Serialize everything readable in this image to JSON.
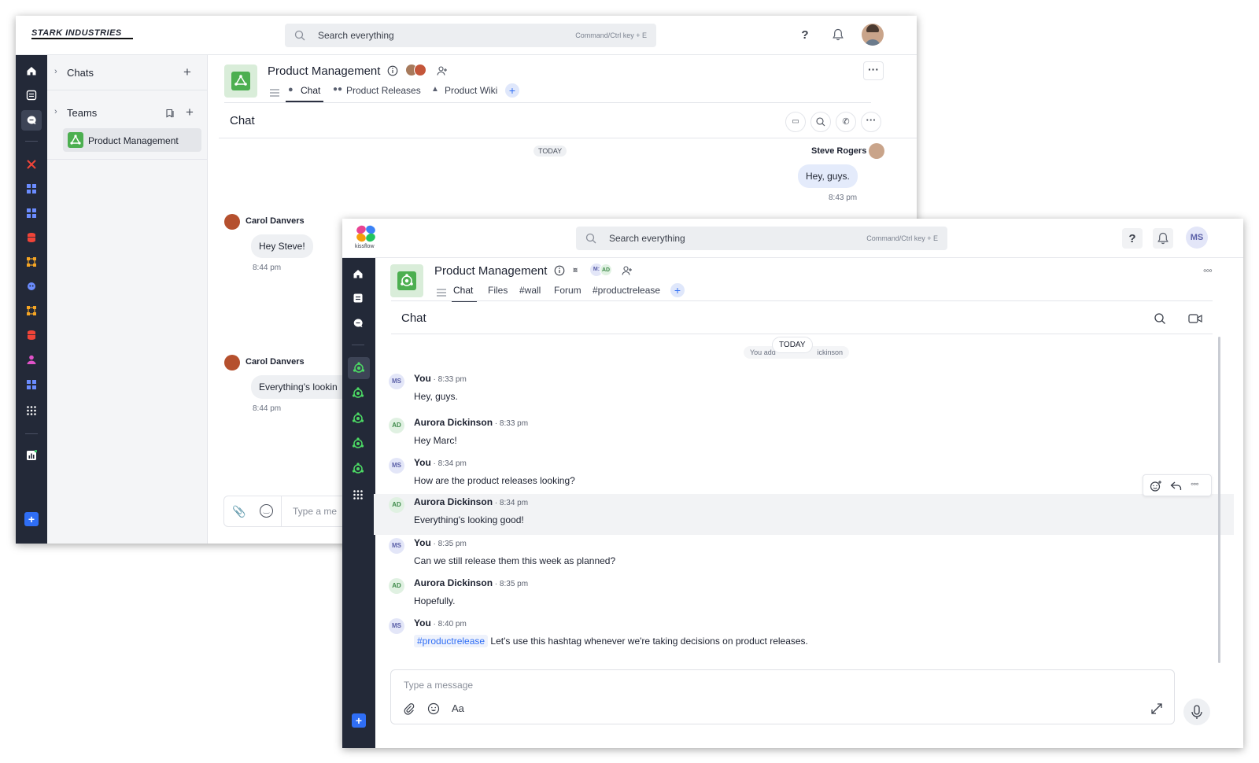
{
  "back_window": {
    "brand": "STARK INDUSTRIES",
    "search": {
      "placeholder": "Search everything",
      "hint": "Command/Ctrl key + E"
    },
    "sidebar": {
      "chats_label": "Chats",
      "teams_label": "Teams",
      "team_item": "Product Management"
    },
    "channel": {
      "title": "Product Management",
      "tabs": [
        "Chat",
        "Product Releases",
        "Product Wiki"
      ]
    },
    "chat_header": "Chat",
    "date_divider": "TODAY",
    "messages": [
      {
        "author": "Steve Rogers",
        "text": "Hey, guys.",
        "time": "8:43 pm"
      },
      {
        "author": "Carol Danvers",
        "text": "Hey Steve!",
        "time": "8:44 pm"
      },
      {
        "author": "Carol Danvers",
        "text": "Everything's lookin",
        "time": "8:44 pm"
      }
    ],
    "composer_placeholder": "Type a me"
  },
  "front_window": {
    "brand": "kissflow",
    "search": {
      "placeholder": "Search everything",
      "hint": "Command/Ctrl key + E"
    },
    "user_initials": "MS",
    "channel": {
      "title": "Product Management",
      "member_initials": [
        "M:",
        "AD"
      ],
      "tabs": [
        "Chat",
        "Files",
        "#wall",
        "Forum",
        "#productrelease"
      ]
    },
    "chat_header": "Chat",
    "date_divider": "TODAY",
    "system_message_left": "You add",
    "system_message_right": "ickinson",
    "messages": [
      {
        "initials": "MS",
        "author": "You",
        "time": "8:33 pm",
        "text": "Hey, guys."
      },
      {
        "initials": "AD",
        "author": "Aurora Dickinson",
        "time": "8:33 pm",
        "text": "Hey Marc!"
      },
      {
        "initials": "MS",
        "author": "You",
        "time": "8:34 pm",
        "text": "How are the product releases looking?"
      },
      {
        "initials": "AD",
        "author": "Aurora Dickinson",
        "time": "8:34 pm",
        "text": "Everything's looking good!"
      },
      {
        "initials": "MS",
        "author": "You",
        "time": "8:35 pm",
        "text": "Can we still release them this week as planned?"
      },
      {
        "initials": "AD",
        "author": "Aurora Dickinson",
        "time": "8:35 pm",
        "text": "Hopefully."
      },
      {
        "initials": "MS",
        "author": "You",
        "time": "8:40 pm",
        "hashtag": "#productrelease",
        "text": "Let's use this hashtag whenever we're taking decisions on product releases."
      }
    ],
    "composer": {
      "placeholder": "Type a message",
      "format_label": "Aa"
    }
  },
  "colors": {
    "rail": "#232938",
    "accent": "#2f6ef5",
    "team_green": "#4caf50",
    "bubble": "#e4ebfb"
  }
}
